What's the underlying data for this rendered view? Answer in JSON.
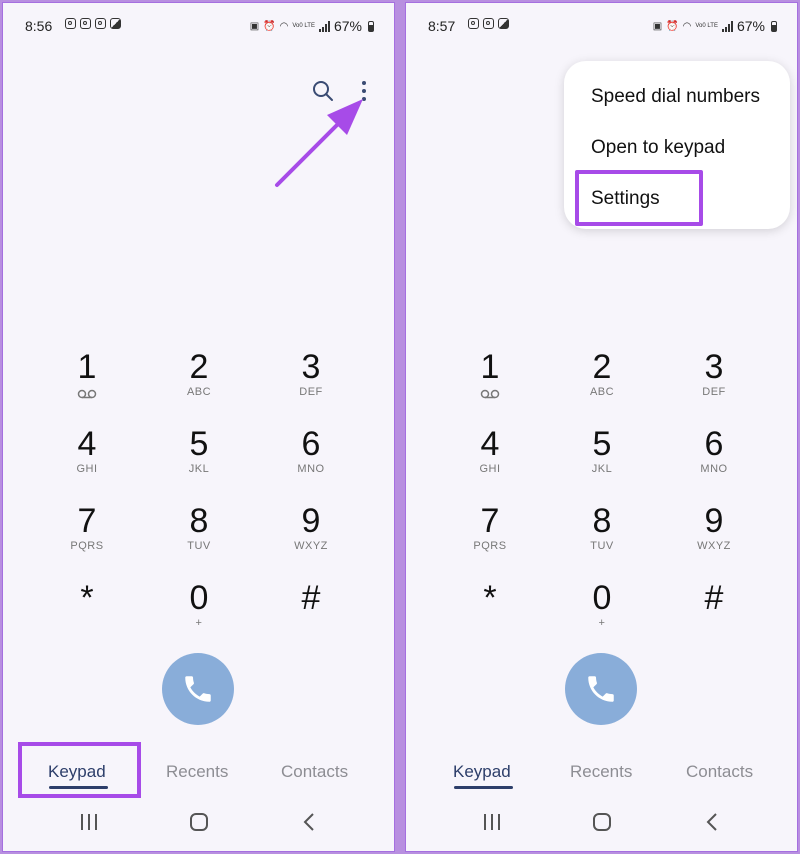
{
  "accent": "#a74be8",
  "screens": [
    {
      "status": {
        "time": "8:56",
        "lte": "Vo0 LTE",
        "battery": "67%"
      },
      "keys": [
        {
          "digit": "1",
          "letters": "",
          "icon": "voicemail-icon"
        },
        {
          "digit": "2",
          "letters": "ABC"
        },
        {
          "digit": "3",
          "letters": "DEF"
        },
        {
          "digit": "4",
          "letters": "GHI"
        },
        {
          "digit": "5",
          "letters": "JKL"
        },
        {
          "digit": "6",
          "letters": "MNO"
        },
        {
          "digit": "7",
          "letters": "PQRS"
        },
        {
          "digit": "8",
          "letters": "TUV"
        },
        {
          "digit": "9",
          "letters": "WXYZ"
        },
        {
          "digit": "*",
          "letters": ""
        },
        {
          "digit": "0",
          "letters": "+"
        },
        {
          "digit": "#",
          "letters": ""
        }
      ],
      "tabs": [
        {
          "label": "Keypad",
          "active": true
        },
        {
          "label": "Recents",
          "active": false
        },
        {
          "label": "Contacts",
          "active": false
        }
      ]
    },
    {
      "status": {
        "time": "8:57",
        "lte": "Vo0 LTE",
        "battery": "67%"
      },
      "menu": {
        "items": [
          "Speed dial numbers",
          "Open to keypad",
          "Settings"
        ]
      },
      "keys": [
        {
          "digit": "1",
          "letters": "",
          "icon": "voicemail-icon"
        },
        {
          "digit": "2",
          "letters": "ABC"
        },
        {
          "digit": "3",
          "letters": "DEF"
        },
        {
          "digit": "4",
          "letters": "GHI"
        },
        {
          "digit": "5",
          "letters": "JKL"
        },
        {
          "digit": "6",
          "letters": "MNO"
        },
        {
          "digit": "7",
          "letters": "PQRS"
        },
        {
          "digit": "8",
          "letters": "TUV"
        },
        {
          "digit": "9",
          "letters": "WXYZ"
        },
        {
          "digit": "*",
          "letters": ""
        },
        {
          "digit": "0",
          "letters": "+"
        },
        {
          "digit": "#",
          "letters": ""
        }
      ],
      "tabs": [
        {
          "label": "Keypad",
          "active": true
        },
        {
          "label": "Recents",
          "active": false
        },
        {
          "label": "Contacts",
          "active": false
        }
      ]
    }
  ]
}
